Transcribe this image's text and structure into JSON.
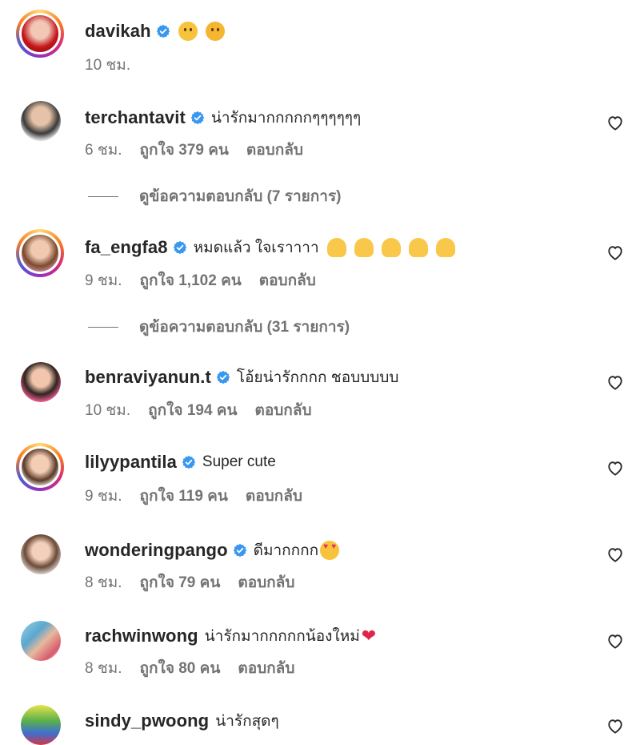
{
  "colors": {
    "verified": "#3897f0",
    "text": "#262626",
    "muted": "#737373",
    "heart": "#e0244a"
  },
  "caption": {
    "username": "davikah",
    "verified": true,
    "emojis": [
      "confused-face",
      "squinting-tongue-face"
    ],
    "time": "10 ชม."
  },
  "comments": [
    {
      "username": "terchantavit",
      "verified": true,
      "text": "น่ารักมากกกกกๆๆๆๆๆๆ",
      "time": "6 ชม.",
      "likes": "ถูกใจ 379 คน",
      "reply": "ตอบกลับ",
      "view_replies": "ดูข้อความตอบกลับ (7 รายการ)"
    },
    {
      "username": "fa_engfa8",
      "verified": true,
      "text": "หมดแล้ว ใจเราาาา",
      "emojis": [
        "hugging-face",
        "hugging-face",
        "hugging-face",
        "hugging-face",
        "hugging-face"
      ],
      "time": "9 ชม.",
      "likes": "ถูกใจ 1,102 คน",
      "reply": "ตอบกลับ",
      "view_replies": "ดูข้อความตอบกลับ (31 รายการ)"
    },
    {
      "username": "benraviyanun.t",
      "verified": true,
      "text": "โอ้ยน่ารักกกก ชอบบบบบ",
      "time": "10 ชม.",
      "likes": "ถูกใจ 194 คน",
      "reply": "ตอบกลับ"
    },
    {
      "username": "lilyypantila",
      "verified": true,
      "text": "Super cute",
      "time": "9 ชม.",
      "likes": "ถูกใจ 119 คน",
      "reply": "ตอบกลับ"
    },
    {
      "username": "wonderingpango",
      "verified": true,
      "text": "ดีมากกกก",
      "emojis": [
        "heart-eyes-face"
      ],
      "time": "8 ชม.",
      "likes": "ถูกใจ 79 คน",
      "reply": "ตอบกลับ"
    },
    {
      "username": "rachwinwong",
      "verified": false,
      "text": "น่ารักมากกกกกน้องใหม่",
      "emojis": [
        "red-heart"
      ],
      "time": "8 ชม.",
      "likes": "ถูกใจ 80 คน",
      "reply": "ตอบกลับ"
    },
    {
      "username": "sindy_pwoong",
      "verified": false,
      "text": "น่ารักสุดๆ"
    }
  ],
  "icons": {
    "verified": "verified-badge-icon",
    "like": "heart-outline-icon"
  }
}
